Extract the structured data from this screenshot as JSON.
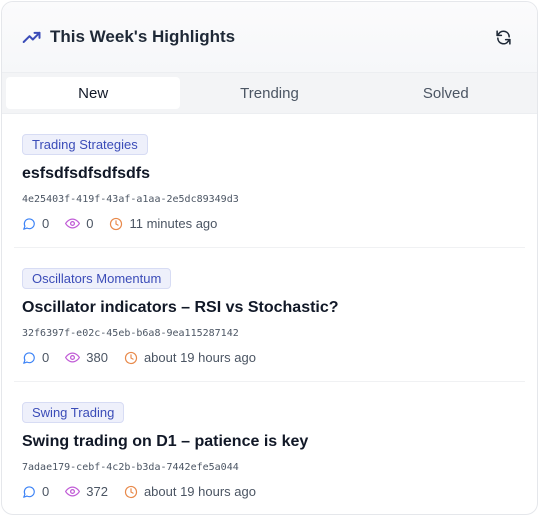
{
  "header": {
    "title": "This Week's Highlights",
    "title_icon": "trending-up-icon",
    "refresh_icon": "refresh-icon",
    "accent_color": "#3b4cb8"
  },
  "tabs": [
    {
      "label": "New",
      "active": true
    },
    {
      "label": "Trending",
      "active": false
    },
    {
      "label": "Solved",
      "active": false
    }
  ],
  "posts": [
    {
      "tag": "Trading Strategies",
      "title": "esfsdfsdfsdfsdfs",
      "id": "4e25403f-419f-43af-a1aa-2e5dc89349d3",
      "comments": "0",
      "views": "0",
      "time": "11 minutes ago"
    },
    {
      "tag": "Oscillators Momentum",
      "title": "Oscillator indicators – RSI vs Stochastic?",
      "id": "32f6397f-e02c-45eb-b6a8-9ea115287142",
      "comments": "0",
      "views": "380",
      "time": "about 19 hours ago"
    },
    {
      "tag": "Swing Trading",
      "title": "Swing trading on D1 – patience is key",
      "id": "7adae179-cebf-4c2b-b3da-7442efe5a044",
      "comments": "0",
      "views": "372",
      "time": "about 19 hours ago"
    }
  ],
  "icon_colors": {
    "comment": "#3b82f6",
    "views": "#c05bd6",
    "clock": "#e8894a"
  }
}
